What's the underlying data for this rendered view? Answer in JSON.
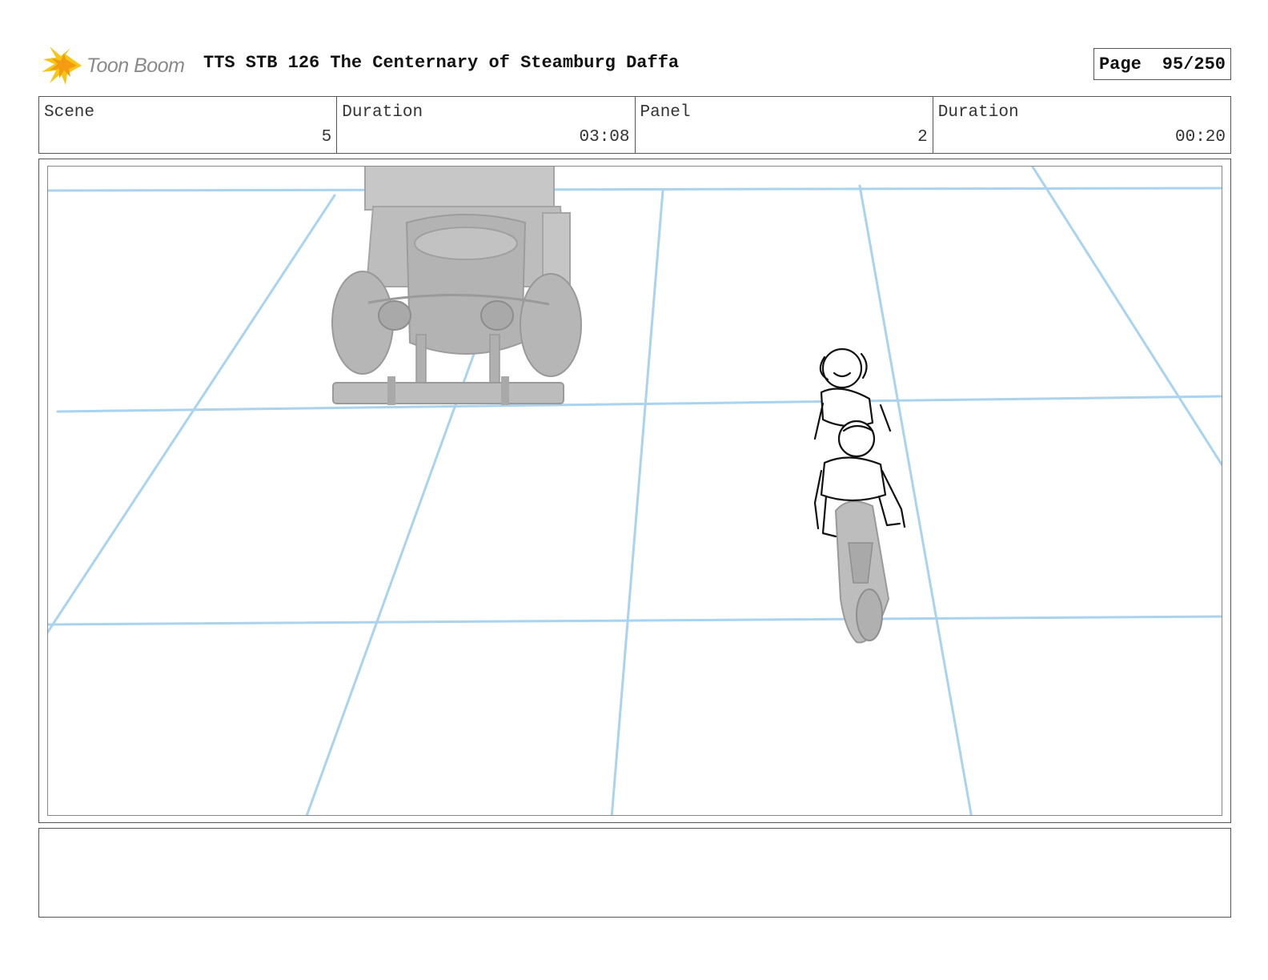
{
  "header": {
    "logo_text": "Toon Boom",
    "title": "TTS STB 126 The Centernary of Steamburg Daffa",
    "page_label": "Page",
    "page_value": "95/250"
  },
  "info": {
    "scene_label": "Scene",
    "scene_value": "5",
    "scene_duration_label": "Duration",
    "scene_duration_value": "03:08",
    "panel_label": "Panel",
    "panel_value": "2",
    "panel_duration_label": "Duration",
    "panel_duration_value": "00:20"
  },
  "notes": {
    "text": ""
  },
  "colors": {
    "grid_line": "#a9d3ee",
    "model_gray": "#bdbdbd",
    "border": "#555555"
  }
}
